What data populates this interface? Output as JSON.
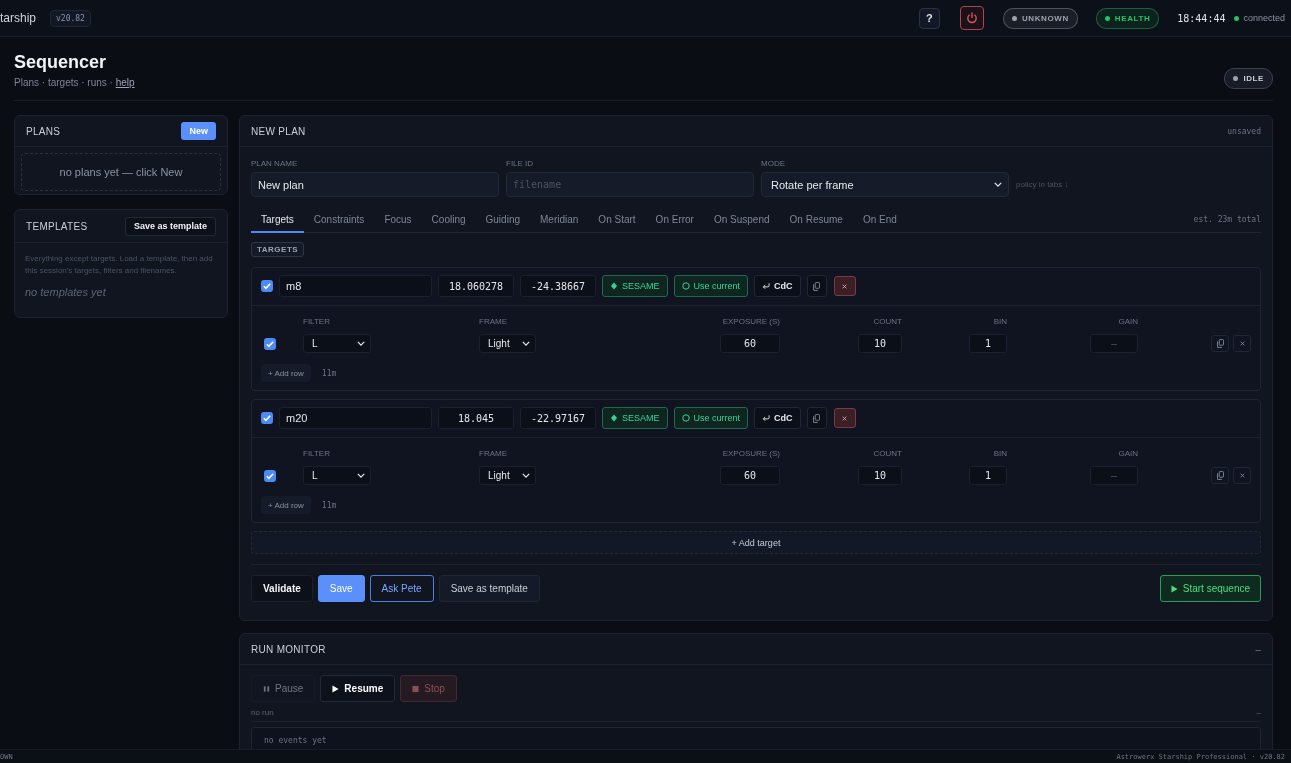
{
  "topbar": {
    "brand": "tarship",
    "version": "v20.82",
    "help_button": "?",
    "status_pills": [
      {
        "label": "UNKNOWN",
        "color": "#9ca3af"
      },
      {
        "label": "HEALTH",
        "color": "#22c55e"
      }
    ],
    "clock": "18:44:44",
    "connection": {
      "label": "connected",
      "color": "#22c55e"
    }
  },
  "header": {
    "title": "Sequencer",
    "subtitle": "Plans · targets · runs ·",
    "help_link": "help",
    "state": {
      "label": "IDLE",
      "color": "#9ca3af"
    }
  },
  "plans_panel": {
    "title": "PLANS",
    "new_button": "New",
    "empty_text": "no plans yet — click New"
  },
  "templates_panel": {
    "title": "TEMPLATES",
    "save_button": "Save as template",
    "description": "Everything except targets. Load a template, then add this session's targets, filters and filenames.",
    "empty_text": "no templates yet"
  },
  "plan": {
    "title": "NEW PLAN",
    "status": "unsaved",
    "fields": [
      {
        "kind": "text",
        "label": "PLAN NAME",
        "value": "New plan"
      },
      {
        "kind": "code",
        "label": "FILE ID",
        "placeholder": "filename"
      },
      {
        "kind": "select",
        "label": "MODE",
        "value": "Rotate per frame",
        "note": "policy in tabs ↓"
      }
    ],
    "tabs": [
      {
        "label": "Targets",
        "selected": true
      },
      {
        "label": "Constraints",
        "selected": false
      },
      {
        "label": "Focus",
        "selected": false
      },
      {
        "label": "Cooling",
        "selected": false
      },
      {
        "label": "Guiding",
        "selected": false
      },
      {
        "label": "Meridian",
        "selected": false
      },
      {
        "label": "On Start",
        "selected": false
      },
      {
        "label": "On Error",
        "selected": false
      },
      {
        "label": "On Suspend",
        "selected": false
      },
      {
        "label": "On Resume",
        "selected": false
      },
      {
        "label": "On End",
        "selected": false
      }
    ],
    "estimate": "est. 23m total",
    "section": "TARGETS",
    "targets": [
      {
        "checked": true,
        "name": "m8",
        "ra": "18.060278",
        "dec": "-24.38667",
        "actions": [
          {
            "kind": "sesame",
            "label": "SESAME"
          },
          {
            "kind": "current",
            "label": "Use current"
          },
          {
            "kind": "cdc",
            "label": "CdC"
          }
        ],
        "columns": [
          "FILTER",
          "FRAME",
          "EXPOSURE (S)",
          "COUNT",
          "BIN",
          "GAIN"
        ],
        "rows": [
          {
            "checked": true,
            "filter": "L",
            "frame": "Light",
            "exposure": "60",
            "count": "10",
            "bin": "1",
            "gain_placeholder": "–"
          }
        ],
        "add_row": "+ Add row",
        "duration": "11m"
      },
      {
        "checked": true,
        "name": "m20",
        "ra": "18.045",
        "dec": "-22.97167",
        "actions": [
          {
            "kind": "sesame",
            "label": "SESAME"
          },
          {
            "kind": "current",
            "label": "Use current"
          },
          {
            "kind": "cdc",
            "label": "CdC"
          }
        ],
        "columns": [
          "FILTER",
          "FRAME",
          "EXPOSURE (S)",
          "COUNT",
          "BIN",
          "GAIN"
        ],
        "rows": [
          {
            "checked": true,
            "filter": "L",
            "frame": "Light",
            "exposure": "60",
            "count": "10",
            "bin": "1",
            "gain_placeholder": "–"
          }
        ],
        "add_row": "+ Add row",
        "duration": "11m"
      }
    ],
    "add_target": "+ Add target",
    "buttons": [
      {
        "kind": "plain",
        "label": "Validate"
      },
      {
        "kind": "primary",
        "label": "Save"
      },
      {
        "kind": "outline",
        "label": "Ask Pete"
      },
      {
        "kind": "muted",
        "label": "Save as template"
      }
    ],
    "start_button": "Start sequence"
  },
  "run_monitor": {
    "title": "RUN MONITOR",
    "collapse": "–",
    "controls": [
      {
        "kind": "pause",
        "label": "Pause",
        "disabled": true
      },
      {
        "kind": "resume",
        "label": "Resume",
        "disabled": false
      },
      {
        "kind": "stop",
        "label": "Stop",
        "disabled": true
      }
    ],
    "status": "no run",
    "status_toggle": "–",
    "events_empty": "no events yet"
  },
  "footer": {
    "left": "OWN",
    "right": "Astrowerx Starship Professional · v20.82"
  }
}
